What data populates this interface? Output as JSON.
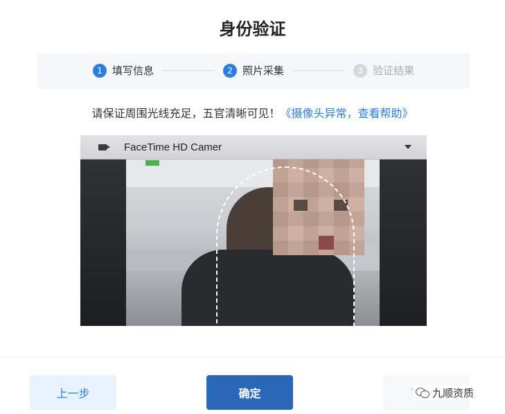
{
  "page": {
    "title": "身份验证"
  },
  "steps": [
    {
      "number": "1",
      "label": "填写信息",
      "state": "active"
    },
    {
      "number": "2",
      "label": "照片采集",
      "state": "active"
    },
    {
      "number": "3",
      "label": "验证结果",
      "state": "inactive"
    }
  ],
  "hint": {
    "text": "请保证周围光线充足，五官清晰可见！",
    "help_link": "《摄像头异常，查看帮助》"
  },
  "camera": {
    "device_name": "FaceTime HD Camer",
    "icon": "video-camera-icon"
  },
  "buttons": {
    "prev": "上一步",
    "ok": "确定",
    "next": "下一步"
  },
  "watermark": {
    "text": "九顺资质",
    "icon": "wechat-icon"
  },
  "colors": {
    "accent": "#2d7de0",
    "primary_button": "#2a67b8",
    "step_inactive": "#d4d8de"
  }
}
